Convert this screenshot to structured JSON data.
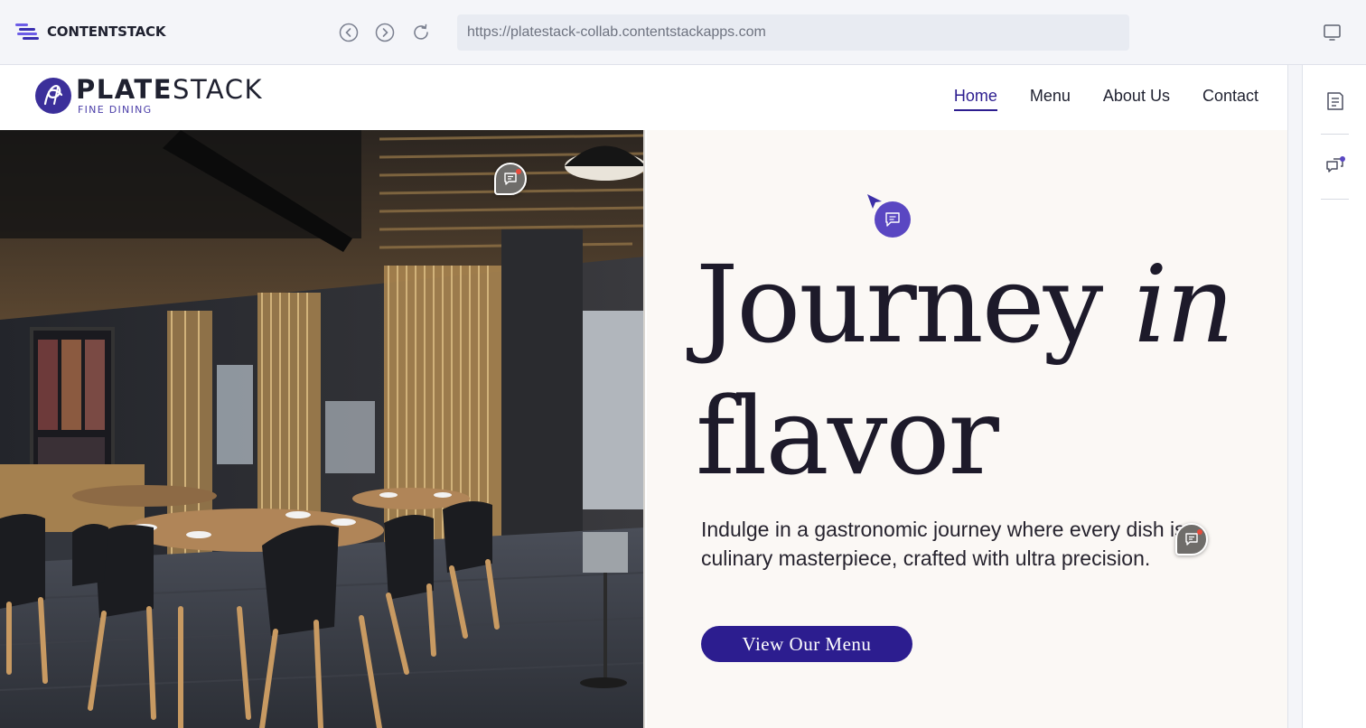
{
  "appbar": {
    "logo_text": "CONTENTSTACK",
    "url": "https://platestack-collab.contentstackapps.com",
    "icons": {
      "back": "chevron-left-circle-icon",
      "forward": "chevron-right-circle-icon",
      "reload": "reload-icon",
      "device": "monitor-icon"
    }
  },
  "site": {
    "brand": {
      "name_bold": "PLATE",
      "name_light": "STACK",
      "tagline": "FINE DINING"
    },
    "nav": [
      {
        "label": "Home",
        "active": true
      },
      {
        "label": "Menu",
        "active": false
      },
      {
        "label": "About Us",
        "active": false
      },
      {
        "label": "Contact",
        "active": false
      }
    ],
    "hero": {
      "title_line1_a": "Journey ",
      "title_line1_b": "in",
      "title_line2": "flavor",
      "description": "Indulge in a gastronomic journey where every dish is a culinary masterpiece, crafted with ultra precision.",
      "cta_label": "View Our Menu",
      "image_alt": "restaurant interior with wooden chairs and slatted screens"
    }
  },
  "sidebar": {
    "icons": [
      "note-icon",
      "comments-icon"
    ]
  },
  "colors": {
    "brand_purple": "#2c1d8f",
    "pin_purple": "#5a47c2",
    "panel_bg": "#fbf8f5",
    "notification_dot": "#e94b3c"
  }
}
